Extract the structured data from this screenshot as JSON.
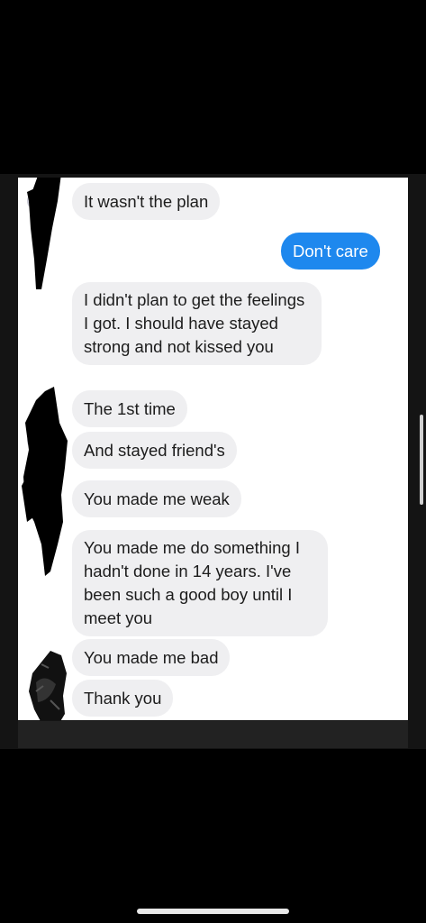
{
  "messages": [
    {
      "side": "received",
      "text": "It wasn't the plan"
    },
    {
      "side": "sent",
      "text": "Don't care"
    },
    {
      "side": "received",
      "text": "I didn't plan to get the feelings I got. I should have stayed strong and not kissed you"
    },
    {
      "side": "received",
      "text": "The 1st time"
    },
    {
      "side": "received",
      "text": "And stayed friend's"
    },
    {
      "side": "received",
      "text": "You made me weak"
    },
    {
      "side": "received",
      "text": "You made me do something I hadn't done in 14 years. I've been such a good boy until I meet you"
    },
    {
      "side": "received",
      "text": "You made me bad"
    },
    {
      "side": "received",
      "text": "Thank you"
    }
  ],
  "colors": {
    "sent_bubble": "#1e88ee",
    "received_bubble": "#efeff1",
    "background": "#000000"
  },
  "icons": [
    "redaction-scribble",
    "scroll-indicator",
    "home-indicator"
  ]
}
